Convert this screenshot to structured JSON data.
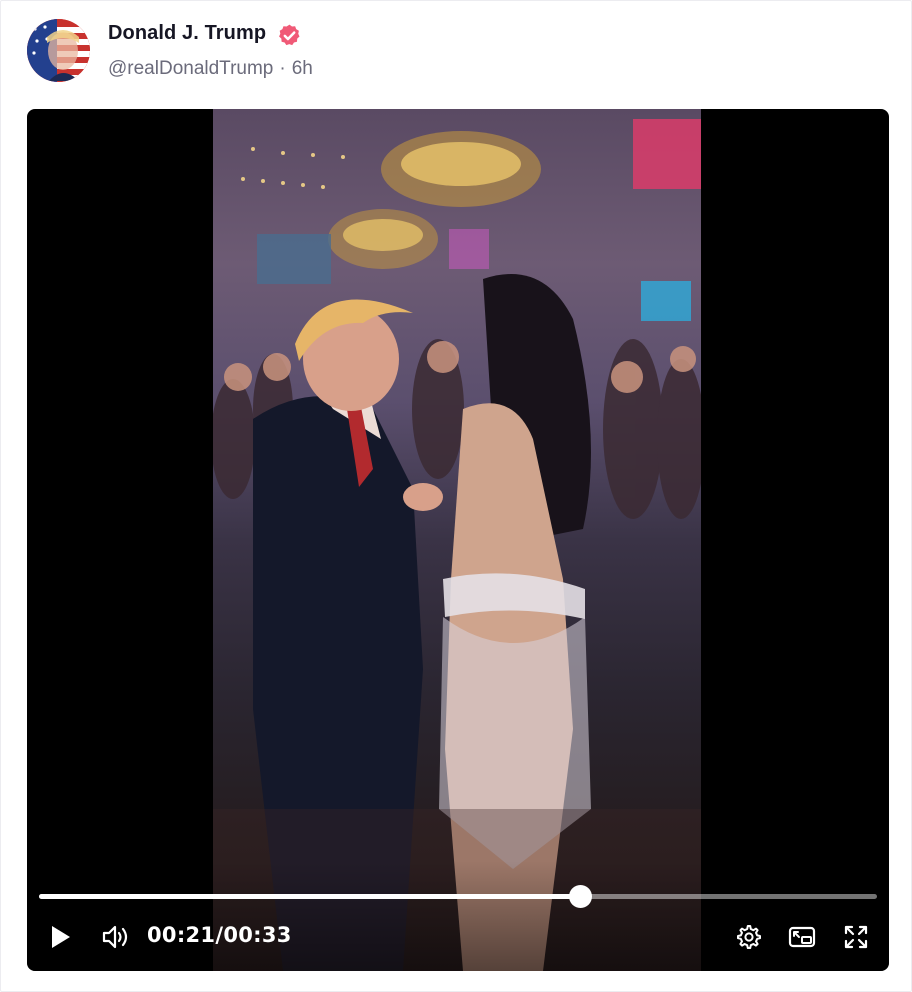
{
  "post": {
    "display_name": "Donald J. Trump",
    "handle": "@realDonaldTrump",
    "separator": "·",
    "time_ago": "6h",
    "verified_color": "#f05a77"
  },
  "video": {
    "current_time": "00:21",
    "time_separator": "/",
    "duration": "00:33",
    "progress": 0.645,
    "controls": {
      "play": "play-icon",
      "volume": "volume-icon",
      "settings": "gear-icon",
      "pip": "picture-in-picture-icon",
      "fullscreen": "fullscreen-icon"
    }
  }
}
